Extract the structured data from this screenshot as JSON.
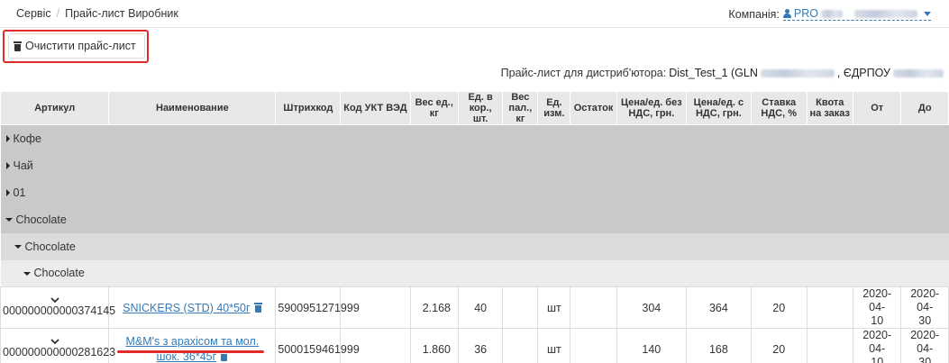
{
  "breadcrumb": {
    "service": "Сервіс",
    "separator": "/",
    "page": "Прайс-лист Виробник"
  },
  "company": {
    "label": "Компанія:",
    "value": "PRO"
  },
  "actions": {
    "clear_label": "Очистити прайс-лист"
  },
  "pricelist": {
    "prefix": "Прайс-лист для дистриб'ютора:",
    "distributor": "Dist_Test_1 (GLN",
    "edrpou_label": ", ЄДРПОУ"
  },
  "columns": [
    "Артикул",
    "Наименование",
    "Штрихкод",
    "Код УКТ ВЭД",
    "Вес ед., кг",
    "Ед. в кор., шт.",
    "Вес пал., кг",
    "Ед. изм.",
    "Остаток",
    "Цена/ед. без НДС, грн.",
    "Цена/ед. с НДС, грн.",
    "Ставка НДС, %",
    "Квота на заказ",
    "От",
    "До"
  ],
  "groups": [
    {
      "label": "Кофе",
      "expanded": false,
      "level": 1
    },
    {
      "label": "Чай",
      "expanded": false,
      "level": 1
    },
    {
      "label": "01",
      "expanded": false,
      "level": 1
    },
    {
      "label": "Chocolate",
      "expanded": true,
      "level": 1
    },
    {
      "label": "Chocolate",
      "expanded": true,
      "level": 2
    },
    {
      "label": "Chocolate",
      "expanded": true,
      "level": 3
    }
  ],
  "rows": [
    {
      "article": "000000000000374145",
      "name": "SNICKERS (STD) 40*50г",
      "barcode": "5900951271999",
      "ukt": "",
      "weight": "2.168",
      "per_box": "40",
      "pallet_weight": "",
      "unit": "шт",
      "stock": "",
      "price_no_vat": "304",
      "price_vat": "364",
      "vat_rate": "20",
      "quota": "",
      "from_line1": "2020-04-",
      "from_line2": "10",
      "to_line1": "2020-04-",
      "to_line2": "30"
    },
    {
      "article": "000000000000281623",
      "name_line1": "M&M's з арахісом та мол.",
      "name_line2": "шок. 36*45г",
      "barcode": "5000159461999",
      "ukt": "",
      "weight": "1.860",
      "per_box": "36",
      "pallet_weight": "",
      "unit": "шт",
      "stock": "",
      "price_no_vat": "140",
      "price_vat": "168",
      "vat_rate": "20",
      "quota": "",
      "from_line1": "2020-04-",
      "from_line2": "10",
      "to_line1": "2020-04-",
      "to_line2": "30"
    }
  ],
  "colors": {
    "accent": "#337ab7",
    "highlight": "#e02b2b",
    "header_bg": "#e8e8e8"
  }
}
